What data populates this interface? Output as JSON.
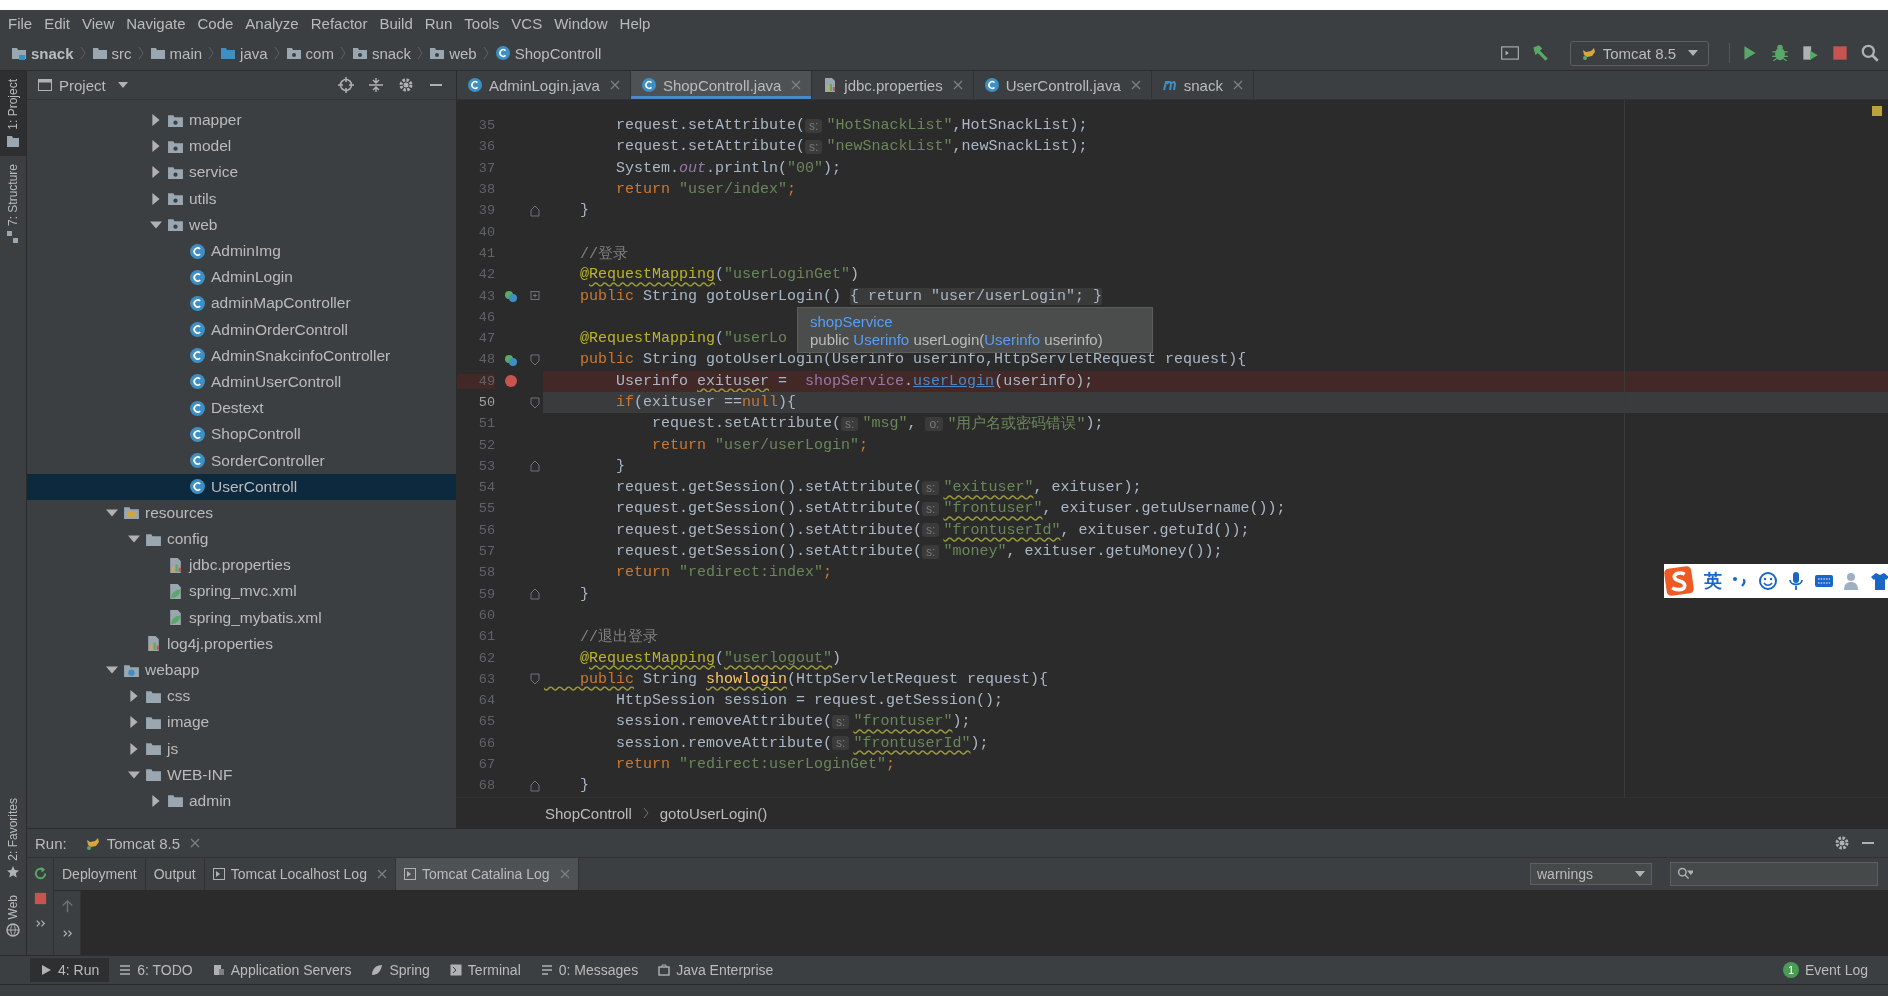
{
  "menu": [
    "File",
    "Edit",
    "View",
    "Navigate",
    "Code",
    "Analyze",
    "Refactor",
    "Build",
    "Run",
    "Tools",
    "VCS",
    "Window",
    "Help"
  ],
  "nav_bar": {
    "crumbs": [
      {
        "label": "snack",
        "kind": "project"
      },
      {
        "label": "src",
        "kind": "folder"
      },
      {
        "label": "main",
        "kind": "folder"
      },
      {
        "label": "java",
        "kind": "source"
      },
      {
        "label": "com",
        "kind": "package"
      },
      {
        "label": "snack",
        "kind": "package"
      },
      {
        "label": "web",
        "kind": "package"
      },
      {
        "label": "ShopControll",
        "kind": "class"
      }
    ],
    "run_config": "Tomcat 8.5"
  },
  "side_strip": {
    "top": [
      {
        "label": "1: Project",
        "kind": "project",
        "selected": true
      },
      {
        "label": "7: Structure",
        "kind": "structure",
        "selected": false
      }
    ],
    "bottom": [
      {
        "label": "2: Favorites",
        "kind": "favorites",
        "selected": false
      },
      {
        "label": "Web",
        "kind": "web",
        "selected": false
      }
    ]
  },
  "project_panel": {
    "title": "Project",
    "tree": {
      "upper_items": [
        {
          "label": "mapper",
          "kind": "package",
          "expanded": false,
          "selected": false
        },
        {
          "label": "model",
          "kind": "package",
          "expanded": false,
          "selected": false
        },
        {
          "label": "service",
          "kind": "package",
          "expanded": false,
          "selected": false
        },
        {
          "label": "utils",
          "kind": "package",
          "expanded": false,
          "selected": false
        },
        {
          "label": "web",
          "kind": "package",
          "expanded": true,
          "selected": false,
          "children": [
            {
              "label": "AdminImg",
              "kind": "class",
              "selected": false
            },
            {
              "label": "AdminLogin",
              "kind": "class",
              "selected": false
            },
            {
              "label": "adminMapController",
              "kind": "class",
              "selected": false
            },
            {
              "label": "AdminOrderControll",
              "kind": "class",
              "selected": false
            },
            {
              "label": "AdminSnakcinfoController",
              "kind": "class",
              "selected": false
            },
            {
              "label": "AdminUserControll",
              "kind": "class",
              "selected": false
            },
            {
              "label": "Destext",
              "kind": "class",
              "selected": false
            },
            {
              "label": "ShopControll",
              "kind": "class",
              "selected": false
            },
            {
              "label": "SorderController",
              "kind": "class",
              "selected": false
            },
            {
              "label": "UserControll",
              "kind": "class",
              "selected": true
            }
          ]
        }
      ],
      "items": [
        {
          "label": "resources",
          "kind": "resources",
          "expanded": true,
          "selected": false,
          "children": [
            {
              "label": "config",
              "kind": "folder",
              "expanded": true,
              "selected": false,
              "children": [
                {
                  "label": "jdbc.properties",
                  "kind": "properties",
                  "selected": false
                },
                {
                  "label": "spring_mvc.xml",
                  "kind": "xml",
                  "selected": false
                },
                {
                  "label": "spring_mybatis.xml",
                  "kind": "xml",
                  "selected": false
                }
              ]
            },
            {
              "label": "log4j.properties",
              "kind": "properties",
              "selected": false
            }
          ]
        },
        {
          "label": "webapp",
          "kind": "webapp",
          "expanded": true,
          "selected": false,
          "children": [
            {
              "label": "css",
              "kind": "folder",
              "expanded": false,
              "selected": false
            },
            {
              "label": "image",
              "kind": "folder",
              "expanded": false,
              "selected": false
            },
            {
              "label": "js",
              "kind": "folder",
              "expanded": false,
              "selected": false
            },
            {
              "label": "WEB-INF",
              "kind": "folder",
              "expanded": true,
              "selected": false,
              "children": [
                {
                  "label": "admin",
                  "kind": "folder",
                  "expanded": false,
                  "selected": false
                }
              ]
            }
          ]
        }
      ]
    }
  },
  "editor": {
    "tabs": [
      {
        "label": "AdminLogin.java",
        "kind": "class",
        "selected": false
      },
      {
        "label": "ShopControll.java",
        "kind": "class",
        "selected": true
      },
      {
        "label": "jdbc.properties",
        "kind": "properties",
        "selected": false
      },
      {
        "label": "UserControll.java",
        "kind": "class",
        "selected": false
      },
      {
        "label": "snack",
        "kind": "module",
        "selected": false
      }
    ],
    "lines": [
      {
        "number": "35",
        "breakpoint": false,
        "current": false,
        "tokens": [
          {
            "kind": "plain",
            "text": "        request.setAttribute("
          },
          {
            "kind": "hint",
            "text": "s:"
          },
          {
            "kind": "str",
            "text": "\"HotSnackList\""
          },
          {
            "kind": "plain",
            "text": ",HotSnackList);"
          }
        ]
      },
      {
        "number": "36",
        "breakpoint": false,
        "current": false,
        "tokens": [
          {
            "kind": "plain",
            "text": "        request.setAttribute("
          },
          {
            "kind": "hint",
            "text": "s:"
          },
          {
            "kind": "str",
            "text": "\"newSnackList\""
          },
          {
            "kind": "plain",
            "text": ",newSnackList);"
          }
        ]
      },
      {
        "number": "37",
        "breakpoint": false,
        "current": false,
        "tokens": [
          {
            "kind": "plain",
            "text": "        System."
          },
          {
            "kind": "static",
            "text": "out"
          },
          {
            "kind": "plain",
            "text": ".println("
          },
          {
            "kind": "str",
            "text": "\"00\""
          },
          {
            "kind": "plain",
            "text": ");"
          }
        ]
      },
      {
        "number": "38",
        "breakpoint": false,
        "current": false,
        "tokens": [
          {
            "kind": "kw",
            "text": "        return "
          },
          {
            "kind": "str",
            "text": "\"user/index\""
          },
          {
            "kind": "kw",
            "text": ";"
          }
        ]
      },
      {
        "number": "39",
        "breakpoint": false,
        "current": false,
        "marks": [
          {
            "kind": "fold_end"
          }
        ],
        "tokens": [
          {
            "kind": "plain",
            "text": "    }"
          }
        ]
      },
      {
        "number": "40",
        "breakpoint": false,
        "current": false
      },
      {
        "number": "41",
        "breakpoint": false,
        "current": false,
        "tokens": [
          {
            "kind": "comment",
            "text": "    //登录"
          }
        ]
      },
      {
        "number": "42",
        "breakpoint": false,
        "current": false,
        "tokens": [
          {
            "kind": "annot",
            "text": "    @"
          },
          {
            "kind": "annot_typo",
            "text": "RequestMapping"
          },
          {
            "kind": "plain",
            "text": "("
          },
          {
            "kind": "str",
            "text": "\"userLoginGet\""
          },
          {
            "kind": "plain",
            "text": ")"
          }
        ]
      },
      {
        "number": "43",
        "breakpoint": false,
        "current": false,
        "marks": [
          {
            "kind": "implements"
          },
          {
            "kind": "folded"
          }
        ],
        "tokens": [
          {
            "kind": "kw",
            "text": "    public "
          },
          {
            "kind": "plain",
            "text": "String gotoUserLogin() "
          },
          {
            "kind": "fold",
            "text": "{ return \"user/userLogin\"; }"
          }
        ]
      },
      {
        "number": "46",
        "breakpoint": false,
        "current": false
      },
      {
        "number": "47",
        "breakpoint": false,
        "current": false,
        "tokens": [
          {
            "kind": "annot",
            "text": "    @RequestMapping"
          },
          {
            "kind": "plain",
            "text": "("
          },
          {
            "kind": "str",
            "text": "\"userLo"
          }
        ]
      },
      {
        "number": "48",
        "breakpoint": false,
        "current": false,
        "marks": [
          {
            "kind": "implements"
          },
          {
            "kind": "fold_start"
          }
        ],
        "tokens": [
          {
            "kind": "kw",
            "text": "    public "
          },
          {
            "kind": "plain",
            "text": "String gotoUserLogin(Userinfo userinfo,HttpServletRequest request){"
          }
        ]
      },
      {
        "number": "49",
        "breakpoint": true,
        "current": false,
        "tokens": [
          {
            "kind": "plain",
            "text": "        Userinfo "
          },
          {
            "kind": "plain_typo",
            "text": "exituser"
          },
          {
            "kind": "plain",
            "text": " =  "
          },
          {
            "kind": "field",
            "text": "shopService"
          },
          {
            "kind": "plain",
            "text": "."
          },
          {
            "kind": "link",
            "text": "userLogin"
          },
          {
            "kind": "plain",
            "text": "(userinfo);"
          }
        ]
      },
      {
        "number": "50",
        "breakpoint": false,
        "current": true,
        "marks": [
          {
            "kind": "fold_start"
          }
        ],
        "tokens": [
          {
            "kind": "kw",
            "text": "        if"
          },
          {
            "kind": "plain",
            "text": "(exituser =="
          },
          {
            "kind": "kw",
            "text": "null"
          },
          {
            "kind": "plain",
            "text": "){"
          }
        ]
      },
      {
        "number": "51",
        "breakpoint": false,
        "current": false,
        "tokens": [
          {
            "kind": "plain",
            "text": "            request.setAttribute("
          },
          {
            "kind": "hint",
            "text": "s:"
          },
          {
            "kind": "str",
            "text": "\"msg\""
          },
          {
            "kind": "plain",
            "text": ", "
          },
          {
            "kind": "hint",
            "text": "o:"
          },
          {
            "kind": "str",
            "text": "\"用户名或密码错误\""
          },
          {
            "kind": "plain",
            "text": ");"
          }
        ]
      },
      {
        "number": "52",
        "breakpoint": false,
        "current": false,
        "tokens": [
          {
            "kind": "kw",
            "text": "            return "
          },
          {
            "kind": "str",
            "text": "\"user/userLogin\""
          },
          {
            "kind": "kw",
            "text": ";"
          }
        ]
      },
      {
        "number": "53",
        "breakpoint": false,
        "current": false,
        "marks": [
          {
            "kind": "fold_end"
          }
        ],
        "tokens": [
          {
            "kind": "plain",
            "text": "        }"
          }
        ]
      },
      {
        "number": "54",
        "breakpoint": false,
        "current": false,
        "tokens": [
          {
            "kind": "plain",
            "text": "        request.getSession().setAttribute("
          },
          {
            "kind": "hint",
            "text": "s:"
          },
          {
            "kind": "str_typo",
            "text": "\"exituser\""
          },
          {
            "kind": "plain",
            "text": ", exituser);"
          }
        ]
      },
      {
        "number": "55",
        "breakpoint": false,
        "current": false,
        "tokens": [
          {
            "kind": "plain",
            "text": "        request.getSession().setAttribute("
          },
          {
            "kind": "hint",
            "text": "s:"
          },
          {
            "kind": "str_typo",
            "text": "\"frontuser\""
          },
          {
            "kind": "plain",
            "text": ", exituser.getuUsername());"
          }
        ]
      },
      {
        "number": "56",
        "breakpoint": false,
        "current": false,
        "tokens": [
          {
            "kind": "plain",
            "text": "        request.getSession().setAttribute("
          },
          {
            "kind": "hint",
            "text": "s:"
          },
          {
            "kind": "str_typo",
            "text": "\"frontuserId\""
          },
          {
            "kind": "plain",
            "text": ", exituser.getuId());"
          }
        ]
      },
      {
        "number": "57",
        "breakpoint": false,
        "current": false,
        "tokens": [
          {
            "kind": "plain",
            "text": "        request.getSession().setAttribute("
          },
          {
            "kind": "hint",
            "text": "s:"
          },
          {
            "kind": "str",
            "text": "\"money\""
          },
          {
            "kind": "plain",
            "text": ", exituser.getuMoney());"
          }
        ]
      },
      {
        "number": "58",
        "breakpoint": false,
        "current": false,
        "tokens": [
          {
            "kind": "kw",
            "text": "        return "
          },
          {
            "kind": "str",
            "text": "\"redirect:index\""
          },
          {
            "kind": "kw",
            "text": ";"
          }
        ]
      },
      {
        "number": "59",
        "breakpoint": false,
        "current": false,
        "marks": [
          {
            "kind": "fold_end"
          }
        ],
        "tokens": [
          {
            "kind": "plain",
            "text": "    }"
          }
        ]
      },
      {
        "number": "60",
        "breakpoint": false,
        "current": false
      },
      {
        "number": "61",
        "breakpoint": false,
        "current": false,
        "tokens": [
          {
            "kind": "comment",
            "text": "    //退出登录"
          }
        ]
      },
      {
        "number": "62",
        "breakpoint": false,
        "current": false,
        "tokens": [
          {
            "kind": "annot",
            "text": "    @"
          },
          {
            "kind": "annot_typo",
            "text": "RequestMapping"
          },
          {
            "kind": "plain",
            "text": "("
          },
          {
            "kind": "str_typo",
            "text": "\"userlogout\""
          },
          {
            "kind": "plain",
            "text": ")"
          }
        ]
      },
      {
        "number": "63",
        "breakpoint": false,
        "current": false,
        "marks": [
          {
            "kind": "fold_start"
          }
        ],
        "tokens": [
          {
            "kind": "kw_typo",
            "text": "    public"
          },
          {
            "kind": "plain",
            "text": " String "
          },
          {
            "kind": "method_typo",
            "text": "showlogin"
          },
          {
            "kind": "plain",
            "text": "(HttpServletRequest request){"
          }
        ]
      },
      {
        "number": "64",
        "breakpoint": false,
        "current": false,
        "tokens": [
          {
            "kind": "plain",
            "text": "        HttpSession session = request.getSession();"
          }
        ]
      },
      {
        "number": "65",
        "breakpoint": false,
        "current": false,
        "tokens": [
          {
            "kind": "plain",
            "text": "        session.removeAttribute("
          },
          {
            "kind": "hint",
            "text": "s:"
          },
          {
            "kind": "str_typo",
            "text": "\"frontuser\""
          },
          {
            "kind": "plain",
            "text": ");"
          }
        ]
      },
      {
        "number": "66",
        "breakpoint": false,
        "current": false,
        "tokens": [
          {
            "kind": "plain",
            "text": "        session.removeAttribute("
          },
          {
            "kind": "hint",
            "text": "s:"
          },
          {
            "kind": "str_typo",
            "text": "\"frontuserId\""
          },
          {
            "kind": "plain",
            "text": ");"
          }
        ]
      },
      {
        "number": "67",
        "breakpoint": false,
        "current": false,
        "tokens": [
          {
            "kind": "kw",
            "text": "        return "
          },
          {
            "kind": "str",
            "text": "\"redirect:userLoginGet\""
          },
          {
            "kind": "kw",
            "text": ";"
          }
        ]
      },
      {
        "number": "68",
        "breakpoint": false,
        "current": false,
        "marks": [
          {
            "kind": "fold_end"
          }
        ],
        "tokens": [
          {
            "kind": "plain",
            "text": "    }"
          }
        ]
      }
    ],
    "tooltip": {
      "title": "shopService",
      "signature": [
        {
          "kind": "plain",
          "text": "public "
        },
        {
          "kind": "type",
          "text": "Userinfo"
        },
        {
          "kind": "plain",
          "text": " userLogin("
        },
        {
          "kind": "type",
          "text": "Userinfo"
        },
        {
          "kind": "plain",
          "text": " userinfo)"
        }
      ]
    },
    "breadcrumbs": [
      "ShopControll",
      "gotoUserLogin()"
    ]
  },
  "run_panel": {
    "label": "Run:",
    "tab": "Tomcat 8.5",
    "log_tabs": [
      {
        "label": "Deployment",
        "kind": "plain",
        "selected": false
      },
      {
        "label": "Output",
        "kind": "plain",
        "selected": false
      },
      {
        "label": "Tomcat Localhost Log",
        "kind": "log",
        "selected": false
      },
      {
        "label": "Tomcat Catalina Log",
        "kind": "log",
        "selected": true
      }
    ],
    "filter": "warnings"
  },
  "tool_tabs": [
    {
      "label": "4: Run",
      "kind": "run",
      "selected": true
    },
    {
      "label": "6: TODO",
      "kind": "todo",
      "selected": false
    },
    {
      "label": "Application Servers",
      "kind": "servers",
      "selected": false
    },
    {
      "label": "Spring",
      "kind": "spring",
      "selected": false
    },
    {
      "label": "Terminal",
      "kind": "terminal",
      "selected": false
    },
    {
      "label": "0: Messages",
      "kind": "messages",
      "selected": false
    },
    {
      "label": "Java Enterprise",
      "kind": "enterprise",
      "selected": false
    }
  ],
  "event_log": {
    "label": "Event Log",
    "count": "1"
  },
  "ime_bar": {
    "mode": "英"
  }
}
